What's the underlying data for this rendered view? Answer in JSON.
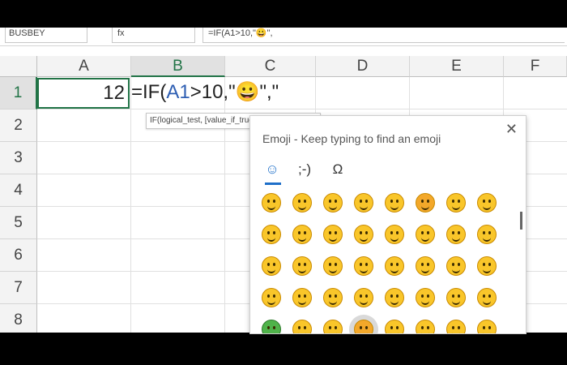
{
  "formula_bar": {
    "name_box": "BUSBEY",
    "function_icon": "fx",
    "formula_preview": "=IF(A1>10,\"😀\","
  },
  "columns": [
    "A",
    "B",
    "C",
    "D",
    "E",
    "F"
  ],
  "rows": [
    "1",
    "2",
    "3",
    "4",
    "5",
    "6",
    "7",
    "8"
  ],
  "cells": {
    "A1": "12",
    "B1_prefix": "=IF(",
    "B1_ref": "A1",
    "B1_suffix": ">10,\"😀\",\""
  },
  "tooltip": "IF(logical_test, [value_if_true], [value_if_false])",
  "emoji_panel": {
    "title": "Emoji - Keep typing to find an emoji",
    "close_label": "✕",
    "tabs": [
      "☺",
      ";-)",
      "Ω"
    ],
    "selected_tab": 0,
    "rows": [
      [
        "grin",
        "grinning-squint",
        "smiling-eyes",
        "slight-smile",
        "hugging",
        "heart-eyes",
        "thinking",
        "hushed"
      ],
      [
        "neutral",
        "expressionless",
        "no-mouth",
        "rolling-eyes",
        "smirk",
        "persevere",
        "sad-relieved",
        "open-mouth"
      ],
      [
        "zipper",
        "hushed-2",
        "sleepy",
        "tired",
        "wink-2",
        "sleeping",
        "relieved",
        "tongue"
      ],
      [
        "winking-tongue",
        "squint-tongue",
        "drool",
        "unamused",
        "sweat",
        "pensive",
        "confused",
        "upside-down"
      ],
      [
        "money-mouth",
        "astonished",
        "frown",
        "angry-red",
        "sob",
        "worried",
        "frustrated",
        "triumph"
      ]
    ]
  },
  "colors": {
    "accent": "#217346",
    "ref": "#2f5fb3",
    "emoji_tab": "#1e6fc9"
  }
}
